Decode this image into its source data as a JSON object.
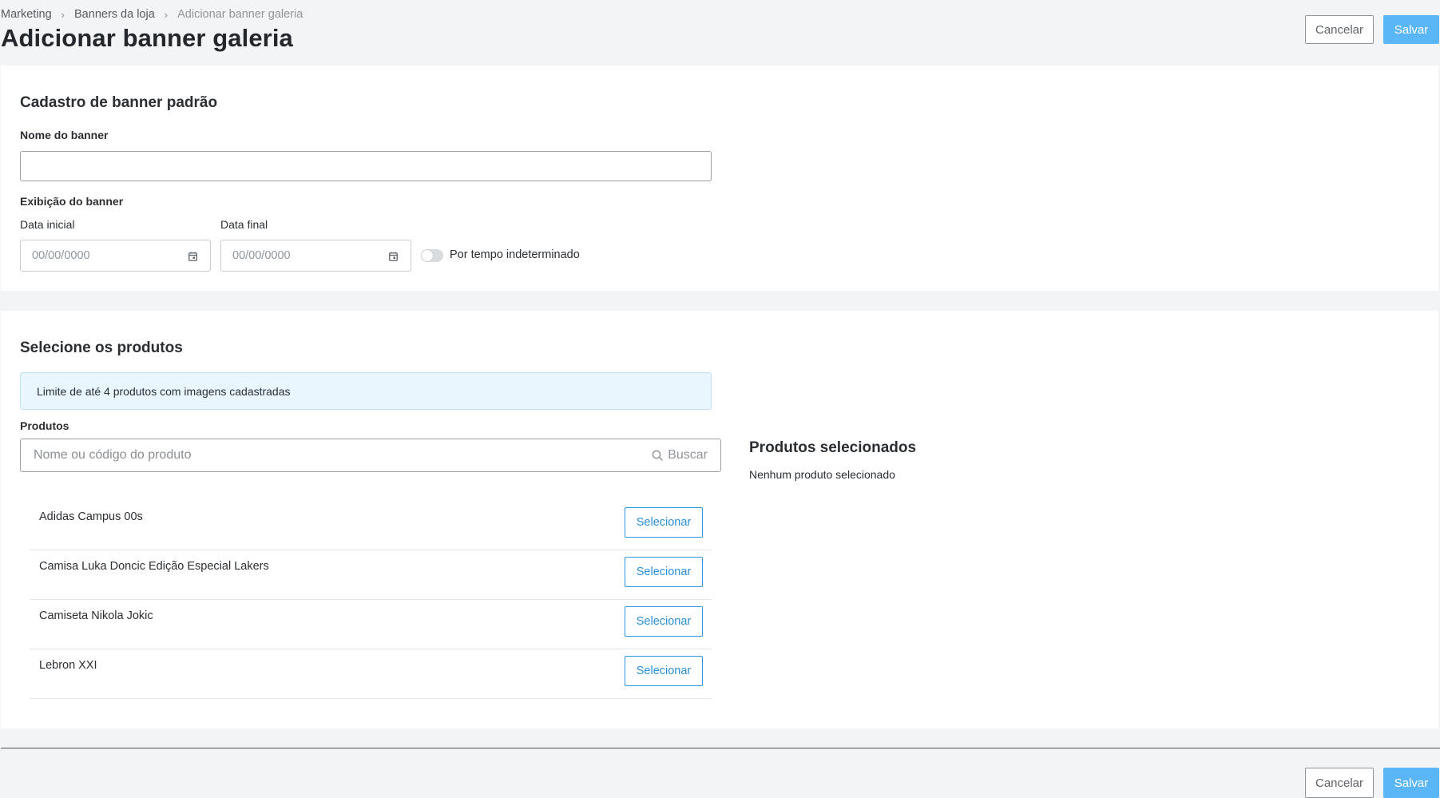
{
  "breadcrumb": {
    "items": [
      "Marketing",
      "Banners da loja",
      "Adicionar banner galeria"
    ]
  },
  "page": {
    "title": "Adicionar banner galeria"
  },
  "actions": {
    "cancel_label": "Cancelar",
    "save_label": "Salvar"
  },
  "banner_form": {
    "title": "Cadastro de banner padrão",
    "name_label": "Nome do banner",
    "name_value": "",
    "display_label": "Exibição do banner",
    "start_date_label": "Data inicial",
    "start_date_placeholder": "00/00/0000",
    "end_date_label": "Data final",
    "end_date_placeholder": "00/00/0000",
    "indefinite_label": "Por tempo indeterminado",
    "indefinite_enabled": false
  },
  "products": {
    "title": "Selecione os produtos",
    "info": "Limite de até 4 produtos com imagens cadastradas",
    "label": "Produtos",
    "search_placeholder": "Nome ou código do produto",
    "search_button": "Buscar",
    "select_label": "Selecionar",
    "items": [
      {
        "name": "Adidas Campus 00s"
      },
      {
        "name": "Camisa Luka Doncic Edição Especial Lakers"
      },
      {
        "name": "Camiseta Nikola Jokic"
      },
      {
        "name": "Lebron XXI"
      }
    ],
    "selected_title": "Produtos selecionados",
    "selected_empty": "Nenhum produto selecionado"
  },
  "colors": {
    "primary": "#5bb6f7",
    "link": "#2b8fd6",
    "info_bg": "#e9f6fe",
    "page_bg": "#f3f4f6"
  }
}
